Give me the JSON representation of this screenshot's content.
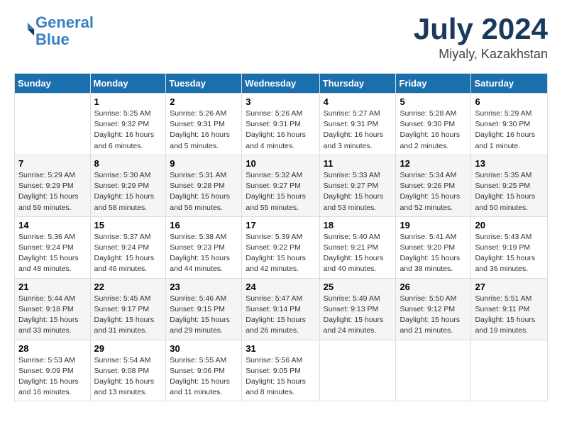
{
  "header": {
    "logo_line1": "General",
    "logo_line2": "Blue",
    "month": "July 2024",
    "location": "Miyaly, Kazakhstan"
  },
  "days_of_week": [
    "Sunday",
    "Monday",
    "Tuesday",
    "Wednesday",
    "Thursday",
    "Friday",
    "Saturday"
  ],
  "weeks": [
    [
      {
        "num": "",
        "info": ""
      },
      {
        "num": "1",
        "info": "Sunrise: 5:25 AM\nSunset: 9:32 PM\nDaylight: 16 hours\nand 6 minutes."
      },
      {
        "num": "2",
        "info": "Sunrise: 5:26 AM\nSunset: 9:31 PM\nDaylight: 16 hours\nand 5 minutes."
      },
      {
        "num": "3",
        "info": "Sunrise: 5:26 AM\nSunset: 9:31 PM\nDaylight: 16 hours\nand 4 minutes."
      },
      {
        "num": "4",
        "info": "Sunrise: 5:27 AM\nSunset: 9:31 PM\nDaylight: 16 hours\nand 3 minutes."
      },
      {
        "num": "5",
        "info": "Sunrise: 5:28 AM\nSunset: 9:30 PM\nDaylight: 16 hours\nand 2 minutes."
      },
      {
        "num": "6",
        "info": "Sunrise: 5:29 AM\nSunset: 9:30 PM\nDaylight: 16 hours\nand 1 minute."
      }
    ],
    [
      {
        "num": "7",
        "info": "Sunrise: 5:29 AM\nSunset: 9:29 PM\nDaylight: 15 hours\nand 59 minutes."
      },
      {
        "num": "8",
        "info": "Sunrise: 5:30 AM\nSunset: 9:29 PM\nDaylight: 15 hours\nand 58 minutes."
      },
      {
        "num": "9",
        "info": "Sunrise: 5:31 AM\nSunset: 9:28 PM\nDaylight: 15 hours\nand 56 minutes."
      },
      {
        "num": "10",
        "info": "Sunrise: 5:32 AM\nSunset: 9:27 PM\nDaylight: 15 hours\nand 55 minutes."
      },
      {
        "num": "11",
        "info": "Sunrise: 5:33 AM\nSunset: 9:27 PM\nDaylight: 15 hours\nand 53 minutes."
      },
      {
        "num": "12",
        "info": "Sunrise: 5:34 AM\nSunset: 9:26 PM\nDaylight: 15 hours\nand 52 minutes."
      },
      {
        "num": "13",
        "info": "Sunrise: 5:35 AM\nSunset: 9:25 PM\nDaylight: 15 hours\nand 50 minutes."
      }
    ],
    [
      {
        "num": "14",
        "info": "Sunrise: 5:36 AM\nSunset: 9:24 PM\nDaylight: 15 hours\nand 48 minutes."
      },
      {
        "num": "15",
        "info": "Sunrise: 5:37 AM\nSunset: 9:24 PM\nDaylight: 15 hours\nand 46 minutes."
      },
      {
        "num": "16",
        "info": "Sunrise: 5:38 AM\nSunset: 9:23 PM\nDaylight: 15 hours\nand 44 minutes."
      },
      {
        "num": "17",
        "info": "Sunrise: 5:39 AM\nSunset: 9:22 PM\nDaylight: 15 hours\nand 42 minutes."
      },
      {
        "num": "18",
        "info": "Sunrise: 5:40 AM\nSunset: 9:21 PM\nDaylight: 15 hours\nand 40 minutes."
      },
      {
        "num": "19",
        "info": "Sunrise: 5:41 AM\nSunset: 9:20 PM\nDaylight: 15 hours\nand 38 minutes."
      },
      {
        "num": "20",
        "info": "Sunrise: 5:43 AM\nSunset: 9:19 PM\nDaylight: 15 hours\nand 36 minutes."
      }
    ],
    [
      {
        "num": "21",
        "info": "Sunrise: 5:44 AM\nSunset: 9:18 PM\nDaylight: 15 hours\nand 33 minutes."
      },
      {
        "num": "22",
        "info": "Sunrise: 5:45 AM\nSunset: 9:17 PM\nDaylight: 15 hours\nand 31 minutes."
      },
      {
        "num": "23",
        "info": "Sunrise: 5:46 AM\nSunset: 9:15 PM\nDaylight: 15 hours\nand 29 minutes."
      },
      {
        "num": "24",
        "info": "Sunrise: 5:47 AM\nSunset: 9:14 PM\nDaylight: 15 hours\nand 26 minutes."
      },
      {
        "num": "25",
        "info": "Sunrise: 5:49 AM\nSunset: 9:13 PM\nDaylight: 15 hours\nand 24 minutes."
      },
      {
        "num": "26",
        "info": "Sunrise: 5:50 AM\nSunset: 9:12 PM\nDaylight: 15 hours\nand 21 minutes."
      },
      {
        "num": "27",
        "info": "Sunrise: 5:51 AM\nSunset: 9:11 PM\nDaylight: 15 hours\nand 19 minutes."
      }
    ],
    [
      {
        "num": "28",
        "info": "Sunrise: 5:53 AM\nSunset: 9:09 PM\nDaylight: 15 hours\nand 16 minutes."
      },
      {
        "num": "29",
        "info": "Sunrise: 5:54 AM\nSunset: 9:08 PM\nDaylight: 15 hours\nand 13 minutes."
      },
      {
        "num": "30",
        "info": "Sunrise: 5:55 AM\nSunset: 9:06 PM\nDaylight: 15 hours\nand 11 minutes."
      },
      {
        "num": "31",
        "info": "Sunrise: 5:56 AM\nSunset: 9:05 PM\nDaylight: 15 hours\nand 8 minutes."
      },
      {
        "num": "",
        "info": ""
      },
      {
        "num": "",
        "info": ""
      },
      {
        "num": "",
        "info": ""
      }
    ]
  ]
}
